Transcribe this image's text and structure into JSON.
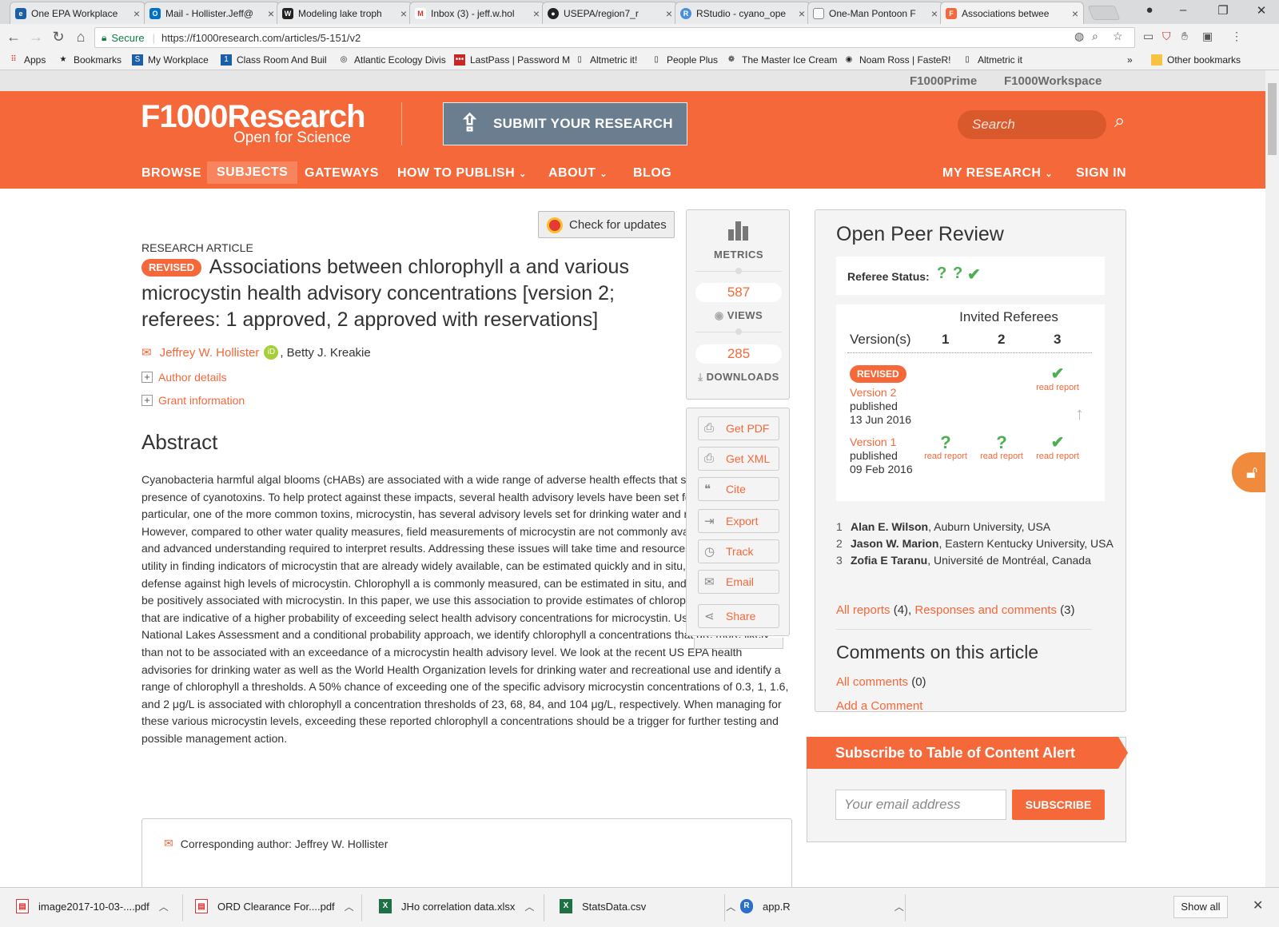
{
  "browser": {
    "tabs": [
      {
        "label": "One EPA Workplace",
        "color": "#1a5fa8"
      },
      {
        "label": "Mail - Hollister.Jeff@",
        "color": "#0072c6"
      },
      {
        "label": "Modeling lake troph",
        "color": "#222222"
      },
      {
        "label": "Inbox (3) - jeff.w.hol",
        "color": "#d93025"
      },
      {
        "label": "USEPA/region7_r",
        "color": "#222222"
      },
      {
        "label": "RStudio - cyano_ope",
        "color": "#4a90d9"
      },
      {
        "label": "One-Man Pontoon F",
        "color": "#888888"
      },
      {
        "label": "Associations betwee",
        "color": "#f4683a"
      }
    ],
    "url_secure": "Secure",
    "url": "https://f1000research.com/articles/5-151/v2",
    "bookmarks": [
      {
        "label": "Apps"
      },
      {
        "label": "Bookmarks"
      },
      {
        "label": "My Workplace"
      },
      {
        "label": "Class Room And Buil"
      },
      {
        "label": "Atlantic Ecology Divis"
      },
      {
        "label": "LastPass | Password M"
      },
      {
        "label": "Altmetric it!"
      },
      {
        "label": "People Plus"
      },
      {
        "label": "The Master Ice Cream"
      },
      {
        "label": "Noam Ross | FasteR!"
      },
      {
        "label": "Altmetric it"
      },
      {
        "label": "Other bookmarks"
      }
    ],
    "more": "»"
  },
  "site": {
    "prebar": [
      "F1000Prime",
      "F1000Workspace"
    ],
    "logo_main": "F1000Research",
    "logo_sub": "Open for Science",
    "submit": "SUBMIT YOUR RESEARCH",
    "search_placeholder": "Search",
    "nav": [
      "BROWSE",
      "SUBJECTS",
      "GATEWAYS",
      "HOW TO PUBLISH",
      "ABOUT",
      "BLOG"
    ],
    "nav_right": [
      "MY RESEARCH",
      "SIGN IN"
    ],
    "accent": "#f4683a"
  },
  "article": {
    "check_updates": "Check for updates",
    "type": "RESEARCH ARTICLE",
    "revised": "REVISED",
    "title": "Associations between chlorophyll a and various microcystin health advisory concentrations [version 2; referees: 1 approved, 2 approved with reservations]",
    "author1": "Jeffrey W. Hollister",
    "author2": ", Betty J. Kreakie",
    "author_details": "Author details",
    "grant_info": "Grant information",
    "abstract_title": "Abstract",
    "abstract": "Cyanobacteria harmful algal blooms (cHABs) are associated with a wide range of adverse health effects that stem mostly from the presence of cyanotoxins. To help protect against these impacts, several health advisory levels have been set for some toxins. In particular, one of the more common toxins, microcystin, has several advisory levels set for drinking water and recreational use. However, compared to other water quality measures, field measurements of microcystin are not commonly available due to cost and advanced understanding required to interpret results. Addressing these issues will take time and resources. Thus, there is utility in finding indicators of microcystin that are already widely available, can be estimated quickly and in situ, and used as a first defense against high levels of microcystin. Chlorophyll a is commonly measured, can be estimated in situ, and has been shown to be positively associated with microcystin. In this paper, we use this association to provide estimates of chlorophyll a concentrations that are indicative of a higher probability of exceeding select health advisory concentrations for microcystin. Using the 2007 National Lakes Assessment and a conditional probability approach, we identify chlorophyll a concentrations that are more likely than not to be associated with an exceedance of a microcystin health advisory level. We look at the recent US EPA health advisories for drinking water as well as the World Health Organization levels for drinking water and recreational use and identify a range of chlorophyll a thresholds. A 50% chance of exceeding one of the specific advisory microcystin concentrations of 0.3, 1, 1.6, and 2 μg/L is associated with chlorophyll a concentration thresholds of 23, 68, 84, and 104 μg/L, respectively. When managing for these various microcystin levels, exceeding these reported chlorophyll a concentrations should be a trigger for further testing and possible management action.",
    "corresponding": "Corresponding author: Jeffrey W. Hollister"
  },
  "metrics": {
    "label": "METRICS",
    "views": "587",
    "views_label": "VIEWS",
    "downloads": "285",
    "downloads_label": "DOWNLOADS"
  },
  "actions": [
    "Get PDF",
    "Get XML",
    "Cite",
    "Export",
    "Track",
    "Email",
    "Share"
  ],
  "peer_review": {
    "title": "Open Peer Review",
    "referee_status_label": "Referee Status:",
    "invited_label": "Invited Referees",
    "versions_label": "Version(s)",
    "cols": [
      "1",
      "2",
      "3"
    ],
    "revised": "REVISED",
    "v2_label": "Version 2",
    "v2_pub": "published",
    "v2_date": "13 Jun 2016",
    "v1_label": "Version 1",
    "v1_pub": "published",
    "v1_date": "09 Feb 2016",
    "read_report": "read report",
    "referees": [
      {
        "n": "1",
        "name": "Alan E. Wilson",
        "aff": ", Auburn University, USA"
      },
      {
        "n": "2",
        "name": "Jason W. Marion",
        "aff": ", Eastern Kentucky University, USA"
      },
      {
        "n": "3",
        "name": "Zofia E Taranu",
        "aff": ", Université de Montréal, Canada"
      }
    ],
    "all_reports": "All reports",
    "all_reports_count": " (4), ",
    "responses": "Responses and comments",
    "responses_count": " (3)"
  },
  "comments": {
    "title": "Comments on this article",
    "all_comments": "All comments",
    "all_comments_count": " (0)",
    "add": "Add a Comment"
  },
  "subscribe": {
    "title": "Subscribe to Table of Content Alert",
    "placeholder": "Your email address",
    "button": "SUBSCRIBE"
  },
  "downloads_bar": {
    "items": [
      {
        "label": "image2017-10-03-....pdf",
        "type": "pdf"
      },
      {
        "label": "ORD Clearance For....pdf",
        "type": "pdf"
      },
      {
        "label": "JHo correlation data.xlsx",
        "type": "xlsx"
      },
      {
        "label": "StatsData.csv",
        "type": "csv"
      },
      {
        "label": "app.R",
        "type": "r"
      }
    ],
    "show_all": "Show all"
  }
}
